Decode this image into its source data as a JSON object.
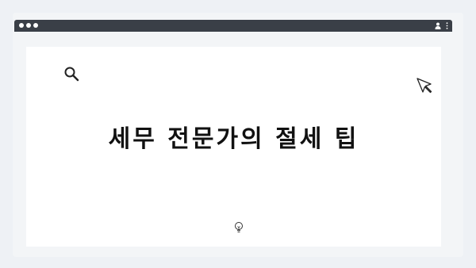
{
  "window": {
    "traffic_lights": [
      "close",
      "minimize",
      "maximize"
    ],
    "titlebar_color": "#3a3f47"
  },
  "page": {
    "title": "세무 전문가의 절세 팁"
  },
  "icons": {
    "search": "search-icon",
    "cursor": "cursor-icon",
    "lightbulb": "lightbulb-icon",
    "user": "user-icon",
    "menu": "kebab-menu-icon"
  },
  "colors": {
    "background": "#eef1f5",
    "content": "#ffffff",
    "title_text": "#111111"
  }
}
